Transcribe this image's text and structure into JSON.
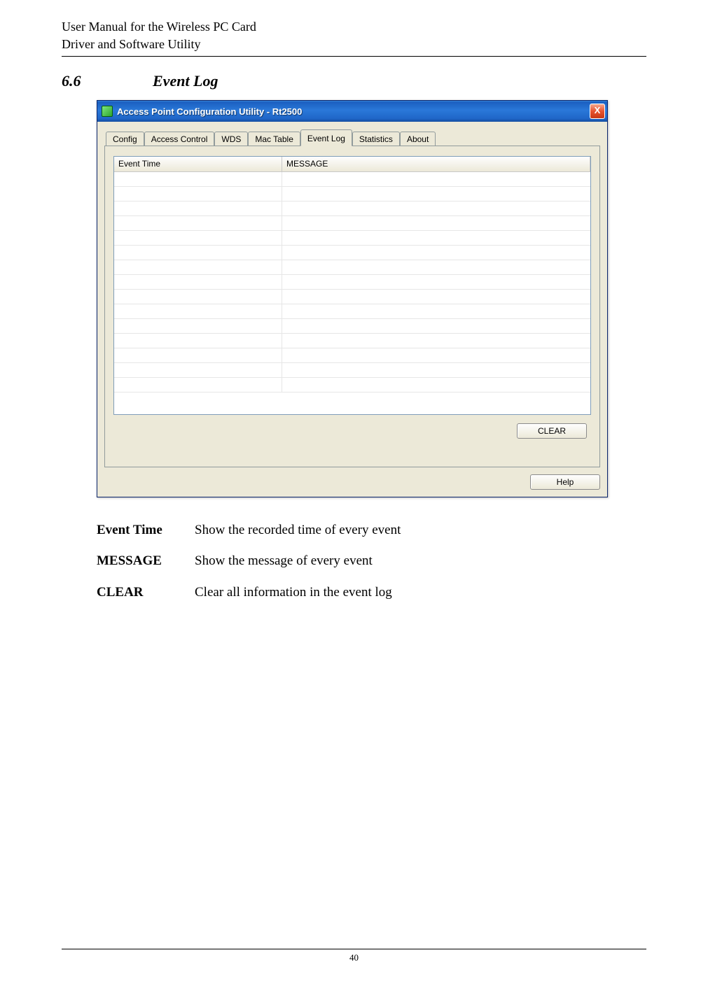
{
  "header": {
    "line1": "User Manual for the Wireless PC Card",
    "line2": "Driver and Software Utility"
  },
  "section": {
    "number": "6.6",
    "title": "Event Log"
  },
  "dialog": {
    "title": "Access Point Configuration Utility - Rt2500",
    "close": "X",
    "tabs": [
      "Config",
      "Access Control",
      "WDS",
      "Mac Table",
      "Event Log",
      "Statistics",
      "About"
    ],
    "active_tab_index": 4,
    "columns": {
      "c1": "Event Time",
      "c2": "MESSAGE"
    },
    "row_count": 15,
    "buttons": {
      "clear": "CLEAR",
      "help": "Help"
    }
  },
  "definitions": [
    {
      "term": "Event Time",
      "desc": "Show the recorded time of every event"
    },
    {
      "term": "MESSAGE",
      "desc": "Show the message of every event"
    },
    {
      "term": "CLEAR",
      "desc": "Clear all information in the event log"
    }
  ],
  "footer": {
    "page": "40"
  }
}
